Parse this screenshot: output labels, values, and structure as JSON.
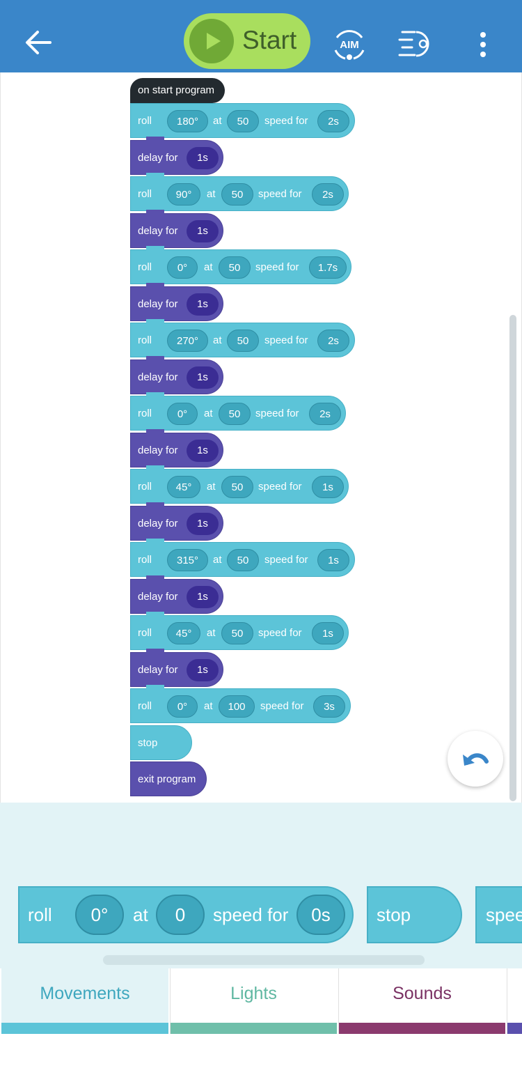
{
  "colors": {
    "topbar": "#3a86c9",
    "start_button": "#a9de5e",
    "roll_block": "#5cc4d8",
    "delay_block": "#5a50ad",
    "hat_block": "#232a2f",
    "movements": "#5cc4d8",
    "lights": "#6fbfaa",
    "sounds": "#8b3a6e",
    "palette_bg": "#e2f3f6"
  },
  "header": {
    "back_icon": "arrow-left-icon",
    "start_label": "Start",
    "play_icon": "play-icon",
    "aim_label": "AIM",
    "list_icon": "program-list-icon",
    "more_icon": "more-vertical-icon"
  },
  "program": {
    "hat_label": "on start program",
    "roll_word": "roll",
    "at_word": "at",
    "speed_word": "speed for",
    "delay_word": "delay for",
    "rolls": [
      {
        "heading": "180°",
        "speed": "50",
        "duration": "2s"
      },
      {
        "heading": "90°",
        "speed": "50",
        "duration": "2s"
      },
      {
        "heading": "0°",
        "speed": "50",
        "duration": "1.7s"
      },
      {
        "heading": "270°",
        "speed": "50",
        "duration": "2s"
      },
      {
        "heading": "0°",
        "speed": "50",
        "duration": "2s"
      },
      {
        "heading": "45°",
        "speed": "50",
        "duration": "1s"
      },
      {
        "heading": "315°",
        "speed": "50",
        "duration": "1s"
      },
      {
        "heading": "45°",
        "speed": "50",
        "duration": "1s"
      },
      {
        "heading": "0°",
        "speed": "100",
        "duration": "3s"
      }
    ],
    "delays": [
      "1s",
      "1s",
      "1s",
      "1s",
      "1s",
      "1s",
      "1s",
      "1s"
    ],
    "stop_label": "stop",
    "exit_label": "exit program"
  },
  "undo_icon": "undo-icon",
  "palette": {
    "roll_word": "roll",
    "heading": "0°",
    "at_word": "at",
    "speed": "0",
    "speed_word": "speed for",
    "duration": "0s",
    "stop_label": "stop",
    "partial_label": "spee"
  },
  "tabs": [
    {
      "label": "Movements",
      "active": true
    },
    {
      "label": "Lights",
      "active": false
    },
    {
      "label": "Sounds",
      "active": false
    }
  ]
}
